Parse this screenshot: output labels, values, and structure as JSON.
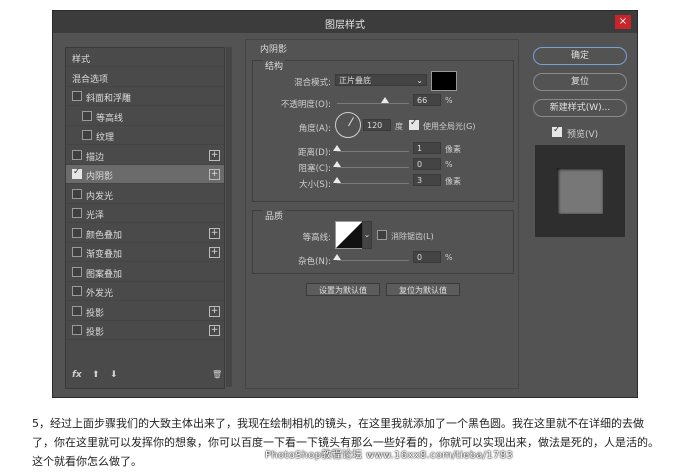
{
  "dialog": {
    "title": "图层样式",
    "close": "×"
  },
  "left": {
    "items": [
      {
        "label": "样式",
        "cb": "none",
        "plus": false,
        "indent": 0,
        "sel": false
      },
      {
        "label": "混合选项",
        "cb": "none",
        "plus": false,
        "indent": 0,
        "sel": false
      },
      {
        "label": "斜面和浮雕",
        "cb": "off",
        "plus": false,
        "indent": 0,
        "sel": false
      },
      {
        "label": "等高线",
        "cb": "off",
        "plus": false,
        "indent": 1,
        "sel": false
      },
      {
        "label": "纹理",
        "cb": "off",
        "plus": false,
        "indent": 1,
        "sel": false
      },
      {
        "label": "描边",
        "cb": "off",
        "plus": true,
        "indent": 0,
        "sel": false
      },
      {
        "label": "内阴影",
        "cb": "on",
        "plus": true,
        "indent": 0,
        "sel": true
      },
      {
        "label": "内发光",
        "cb": "off",
        "plus": false,
        "indent": 0,
        "sel": false
      },
      {
        "label": "光泽",
        "cb": "off",
        "plus": false,
        "indent": 0,
        "sel": false
      },
      {
        "label": "颜色叠加",
        "cb": "off",
        "plus": true,
        "indent": 0,
        "sel": false
      },
      {
        "label": "渐变叠加",
        "cb": "off",
        "plus": true,
        "indent": 0,
        "sel": false
      },
      {
        "label": "图案叠加",
        "cb": "off",
        "plus": false,
        "indent": 0,
        "sel": false
      },
      {
        "label": "外发光",
        "cb": "off",
        "plus": false,
        "indent": 0,
        "sel": false
      },
      {
        "label": "投影",
        "cb": "off",
        "plus": true,
        "indent": 0,
        "sel": false
      },
      {
        "label": "投影",
        "cb": "off",
        "plus": true,
        "indent": 0,
        "sel": false
      }
    ],
    "fx": "fx",
    "up": "⬆",
    "down": "⬇",
    "trash": "🗑"
  },
  "panel": {
    "title": "内阴影",
    "structure": {
      "title": "结构",
      "blend_label": "混合模式:",
      "blend_value": "正片叠底",
      "opacity_label": "不透明度(O):",
      "opacity_value": "66",
      "opacity_pct": 0.66,
      "pct": "%",
      "angle_label": "角度(A):",
      "angle_value": "120",
      "degree": "度",
      "global_light": "使用全局光(G)",
      "distance_label": "距离(D):",
      "distance_value": "1",
      "choke_label": "阻塞(C):",
      "choke_value": "0",
      "size_label": "大小(S):",
      "size_value": "3",
      "px": "像素"
    },
    "quality": {
      "title": "品质",
      "contour_label": "等高线:",
      "antialias": "消除锯齿(L)",
      "noise_label": "杂色(N):",
      "noise_value": "0"
    },
    "default_btn": "设置为默认值",
    "reset_btn": "复位为默认值"
  },
  "right": {
    "ok": "确定",
    "reset": "复位",
    "new_style": "新建样式(W)...",
    "preview": "预览(V)"
  },
  "caption": "5，经过上面步骤我们的大致主体出来了，我现在绘制相机的镜头，在这里我就添加了一个黑色圆。我在这里就不在详细的去做了，你在这里就可以发挥你的想象，你可以百度一下看一下镜头有那么一些好看的，你就可以实现出来，做法是死的，人是活的。这个就看你怎么做了。",
  "watermark": "PhotoShop教程论坛   www.16xx8.com/tieba/1783"
}
